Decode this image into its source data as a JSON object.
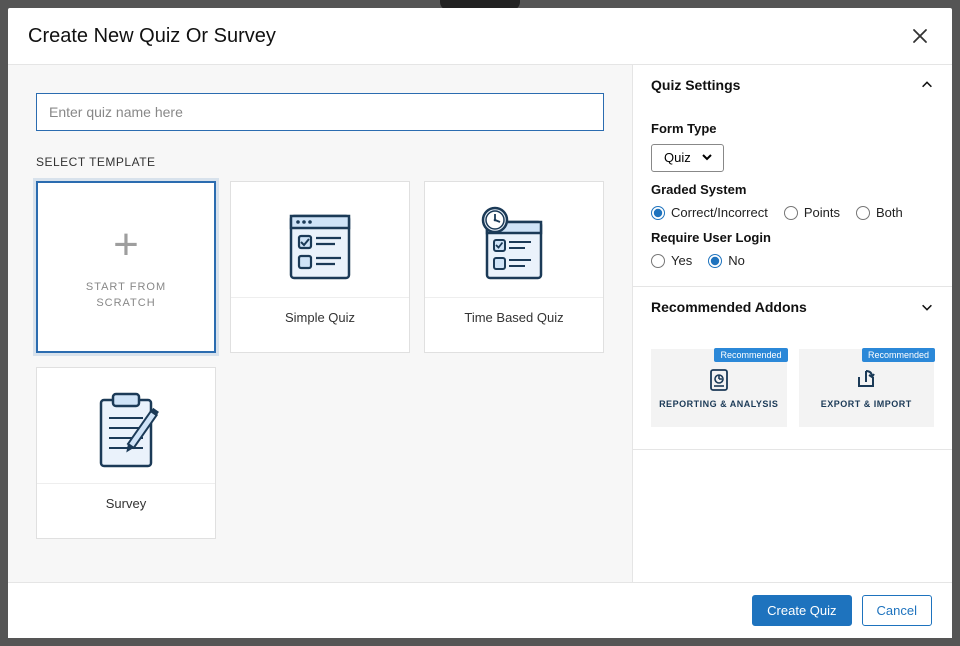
{
  "header": {
    "title": "Create New Quiz Or Survey"
  },
  "name_input": {
    "placeholder": "Enter quiz name here",
    "value": ""
  },
  "templates": {
    "section_label": "SELECT TEMPLATE",
    "items": [
      {
        "id": "scratch",
        "label": "START FROM\nSCRATCH",
        "selected": true
      },
      {
        "id": "simple",
        "label": "Simple Quiz",
        "selected": false
      },
      {
        "id": "timed",
        "label": "Time Based Quiz",
        "selected": false
      },
      {
        "id": "survey",
        "label": "Survey",
        "selected": false
      }
    ]
  },
  "settings": {
    "title": "Quiz Settings",
    "form_type": {
      "label": "Form Type",
      "selected": "Quiz",
      "options": [
        "Quiz"
      ]
    },
    "graded_system": {
      "label": "Graded System",
      "options": [
        "Correct/Incorrect",
        "Points",
        "Both"
      ],
      "selected": "Correct/Incorrect"
    },
    "require_login": {
      "label": "Require User Login",
      "options": [
        "Yes",
        "No"
      ],
      "selected": "No"
    }
  },
  "addons": {
    "title": "Recommended Addons",
    "items": [
      {
        "id": "reporting",
        "label": "REPORTING & ANALYSIS",
        "badge": "Recommended"
      },
      {
        "id": "export",
        "label": "EXPORT & IMPORT",
        "badge": "Recommended"
      }
    ]
  },
  "footer": {
    "primary": "Create Quiz",
    "secondary": "Cancel"
  }
}
